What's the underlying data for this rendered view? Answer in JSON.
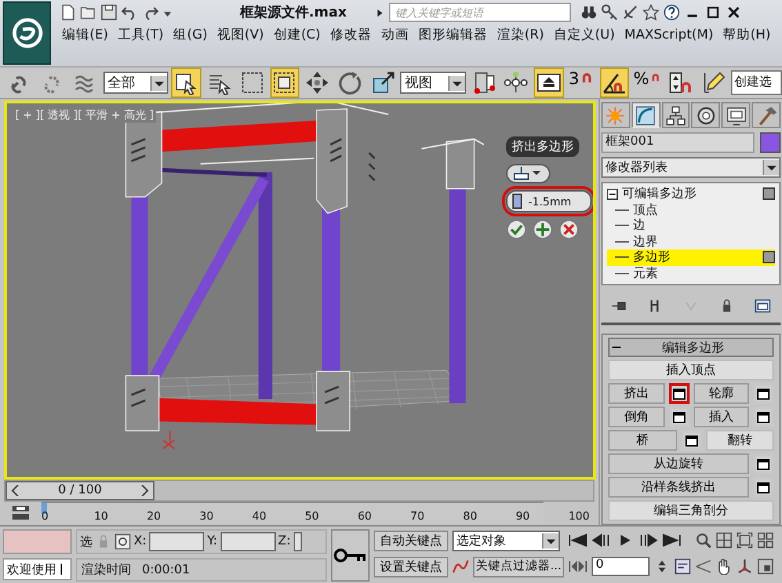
{
  "title_bar": {
    "file_title": "框架源文件.max",
    "search": {
      "placeholder": "键入关键字或短语"
    }
  },
  "menu": [
    "编辑(E)",
    "工具(T)",
    "组(G)",
    "视图(V)",
    "创建(C)",
    "修改器",
    "动画",
    "图形编辑器",
    "渲染(R)",
    "自定义(U)",
    "MAXScript(M)",
    "帮助(H)"
  ],
  "toolbar": {
    "items": [
      {
        "kind": "tool",
        "on": false
      },
      {
        "kind": "tool",
        "on": false
      },
      {
        "kind": "tool",
        "on": false
      },
      {
        "kind": "dropdown",
        "text": "全部"
      },
      {
        "kind": "tool",
        "on": true
      },
      {
        "kind": "tool",
        "on": false
      },
      {
        "kind": "tool",
        "on": false
      },
      {
        "kind": "tool",
        "on": true
      },
      {
        "kind": "tool",
        "on": false
      },
      {
        "kind": "tool",
        "on": false
      },
      {
        "kind": "tool",
        "on": false
      },
      {
        "kind": "dropdown",
        "text": "视图"
      },
      {
        "kind": "tool",
        "on": false
      },
      {
        "kind": "tool",
        "on": false
      },
      {
        "kind": "tool",
        "on": true
      },
      {
        "kind": "snap",
        "label": "3",
        "on": false
      },
      {
        "kind": "tool",
        "on": true
      },
      {
        "kind": "snap",
        "label": "%",
        "on": false
      },
      {
        "kind": "tool",
        "on": false
      },
      {
        "kind": "tool",
        "on": false
      },
      {
        "kind": "field",
        "text": "创建选"
      }
    ]
  },
  "viewport": {
    "label": "[ + ][ 透视 ][ 平滑 + 高光 ]",
    "caddy": {
      "title": "挤出多边形",
      "value": "-1.5mm"
    }
  },
  "command_panel": {
    "tabs": [
      {
        "selected": false
      },
      {
        "selected": true
      },
      {
        "selected": false
      },
      {
        "selected": false
      },
      {
        "selected": false
      },
      {
        "selected": false
      }
    ],
    "object_name": "框架001",
    "modifier_list": "修改器列表",
    "stack": [
      {
        "label": "可编辑多边形",
        "expanded": true,
        "children": [
          {
            "label": "顶点",
            "selected": false
          },
          {
            "label": "边",
            "selected": false
          },
          {
            "label": "边界",
            "selected": false
          },
          {
            "label": "多边形",
            "selected": true
          },
          {
            "label": "元素",
            "selected": false
          }
        ]
      }
    ],
    "rollout": {
      "title": "编辑多边形",
      "expanded": true,
      "rows": [
        [
          {
            "label": "插入顶点",
            "settings": false
          }
        ],
        [
          {
            "label": "挤出",
            "settings": true,
            "highlighted": true
          },
          {
            "label": "轮廓",
            "settings": true,
            "highlighted": false
          }
        ],
        [
          {
            "label": "倒角",
            "settings": true,
            "highlighted": false
          },
          {
            "label": "插入",
            "settings": true,
            "highlighted": false
          }
        ],
        [
          {
            "label": "桥",
            "settings": true,
            "highlighted": false
          },
          {
            "label": "翻转",
            "settings": false
          }
        ],
        [
          {
            "label": "从边旋转",
            "settings": true,
            "highlighted": false
          }
        ],
        [
          {
            "label": "沿样条线挤出",
            "settings": true,
            "highlighted": false
          }
        ],
        [
          {
            "label": "编辑三角剖分",
            "settings": false
          }
        ]
      ]
    }
  },
  "time_slider": {
    "label": "0 / 100",
    "level": 0
  },
  "ruler": [
    "0",
    "10",
    "20",
    "30",
    "40",
    "50",
    "60",
    "70",
    "80",
    "90",
    "100"
  ],
  "status_bar": {
    "selection_label": "选",
    "x_label": "X:",
    "y_label": "Y:",
    "z_label": "Z:",
    "prompt": "欢迎使用",
    "render_time_label": "渲染时间",
    "render_time": "0:00:01",
    "auto_key": "自动关键点",
    "set_key": "设置关键点",
    "key_target": "选定对象",
    "key_filters": "关键点过滤器...",
    "frame": "0"
  }
}
